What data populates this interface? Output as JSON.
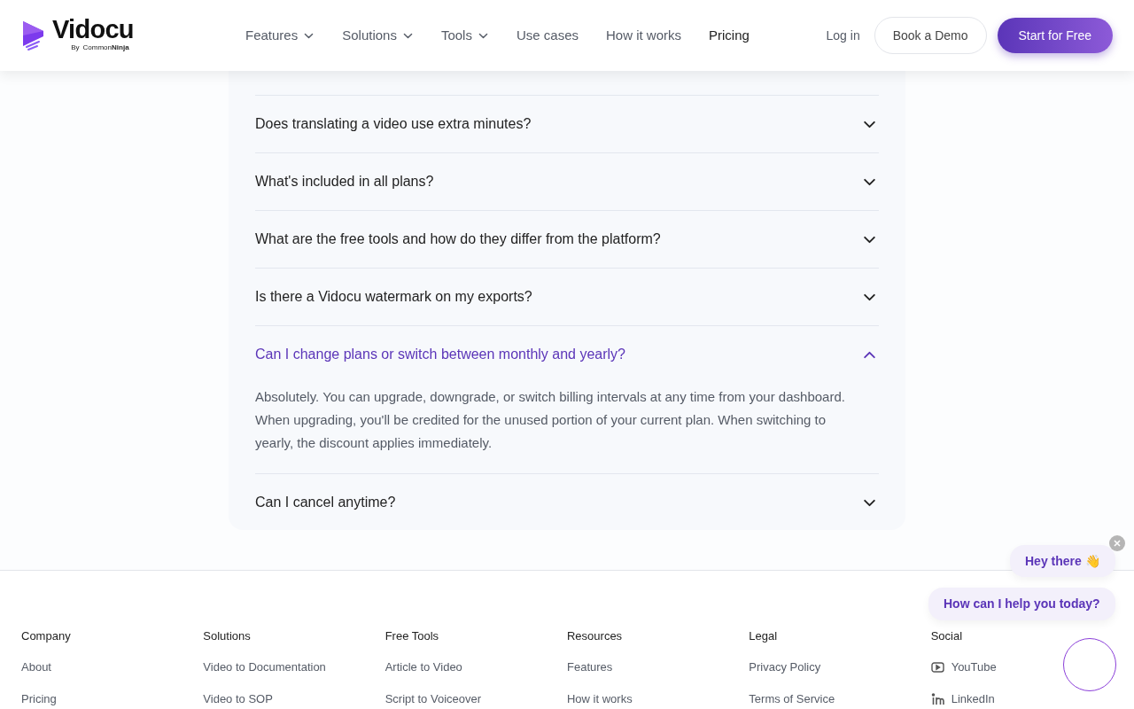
{
  "header": {
    "logo": {
      "name": "Vidocu",
      "byline_prefix": "By",
      "byline": "Common**Ninja**"
    },
    "nav": [
      {
        "label": "Features",
        "dropdown": true,
        "selected": false
      },
      {
        "label": "Solutions",
        "dropdown": true,
        "selected": false
      },
      {
        "label": "Tools",
        "dropdown": true,
        "selected": false
      },
      {
        "label": "Use cases",
        "dropdown": false,
        "selected": false
      },
      {
        "label": "How it works",
        "dropdown": false,
        "selected": false
      },
      {
        "label": "Pricing",
        "dropdown": false,
        "selected": true
      }
    ],
    "login": "Log in",
    "demo": "Book a Demo",
    "start": "Start for Free"
  },
  "faq": [
    {
      "question": "Does translating a video use extra minutes?",
      "expanded": false
    },
    {
      "question": "What's included in all plans?",
      "expanded": false
    },
    {
      "question": "What are the free tools and how do they differ from the platform?",
      "expanded": false
    },
    {
      "question": "Is there a Vidocu watermark on my exports?",
      "expanded": false
    },
    {
      "question": "Can I change plans or switch between monthly and yearly?",
      "expanded": true,
      "answer": "Absolutely. You can upgrade, downgrade, or switch billing intervals at any time from your dashboard. When upgrading, you'll be credited for the unused portion of your current plan. When switching to yearly, the discount applies immediately."
    },
    {
      "question": "Can I cancel anytime?",
      "expanded": false
    }
  ],
  "footer": [
    {
      "heading": "Company",
      "links": [
        {
          "label": "About"
        },
        {
          "label": "Pricing"
        }
      ]
    },
    {
      "heading": "Solutions",
      "links": [
        {
          "label": "Video to Documentation"
        },
        {
          "label": "Video to SOP"
        }
      ]
    },
    {
      "heading": "Free Tools",
      "links": [
        {
          "label": "Article to Video"
        },
        {
          "label": "Script to Voiceover"
        }
      ]
    },
    {
      "heading": "Resources",
      "links": [
        {
          "label": "Features"
        },
        {
          "label": "How it works"
        }
      ]
    },
    {
      "heading": "Legal",
      "links": [
        {
          "label": "Privacy Policy"
        },
        {
          "label": "Terms of Service"
        }
      ]
    },
    {
      "heading": "Social",
      "links": [
        {
          "label": "YouTube",
          "kind": "youtube"
        },
        {
          "label": "LinkedIn",
          "kind": "linkedin"
        }
      ]
    }
  ],
  "chat": {
    "greeting": "Hey there 👋",
    "prompt": "How can I help you today?"
  }
}
